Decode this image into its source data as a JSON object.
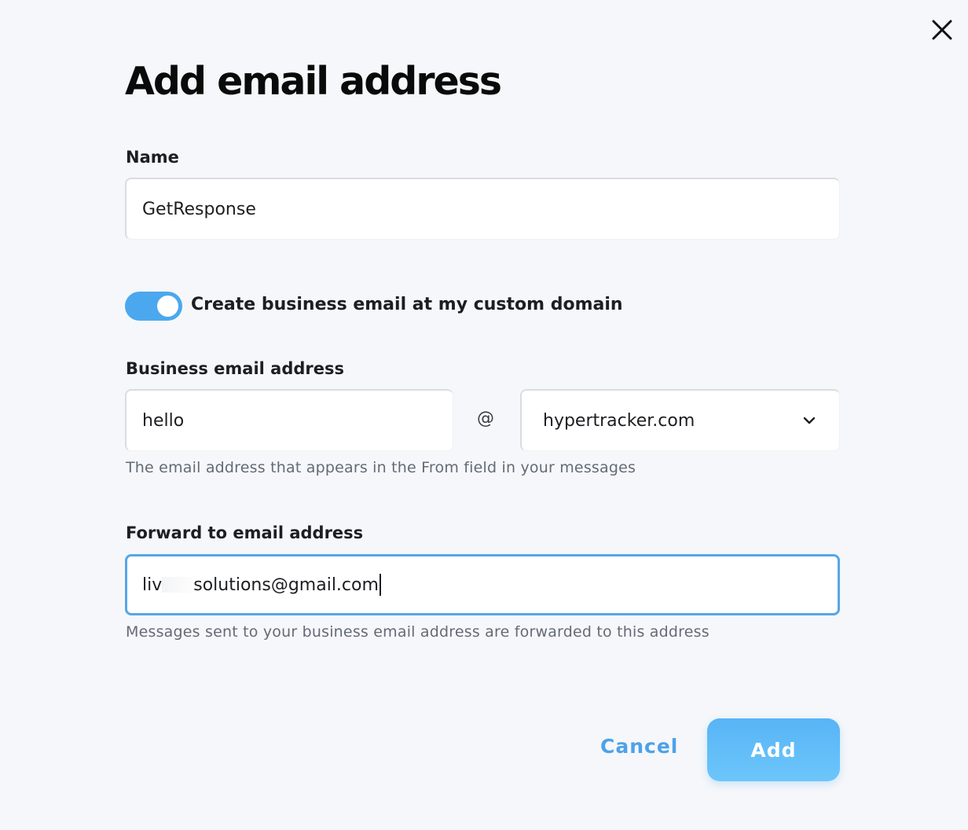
{
  "dialog": {
    "title": "Add email address"
  },
  "name_field": {
    "label": "Name",
    "value": "GetResponse"
  },
  "custom_domain_toggle": {
    "label": "Create business email at my custom domain",
    "enabled": true
  },
  "business_email": {
    "label": "Business email address",
    "local_part": "hello",
    "at_symbol": "@",
    "domain": "hypertracker.com",
    "help": "The email address that appears in the From field in your messages"
  },
  "forward_email": {
    "label": "Forward to email address",
    "value_start": "liv",
    "value_end": "solutions@gmail.com",
    "help": "Messages sent to your business email address are forwarded to this address"
  },
  "actions": {
    "cancel_label": "Cancel",
    "add_label": "Add"
  },
  "colors": {
    "accent": "#4ba8ee",
    "background": "#f5f7fa"
  },
  "icons": {
    "close": "close-icon",
    "dropdown": "chevron-down-icon"
  }
}
